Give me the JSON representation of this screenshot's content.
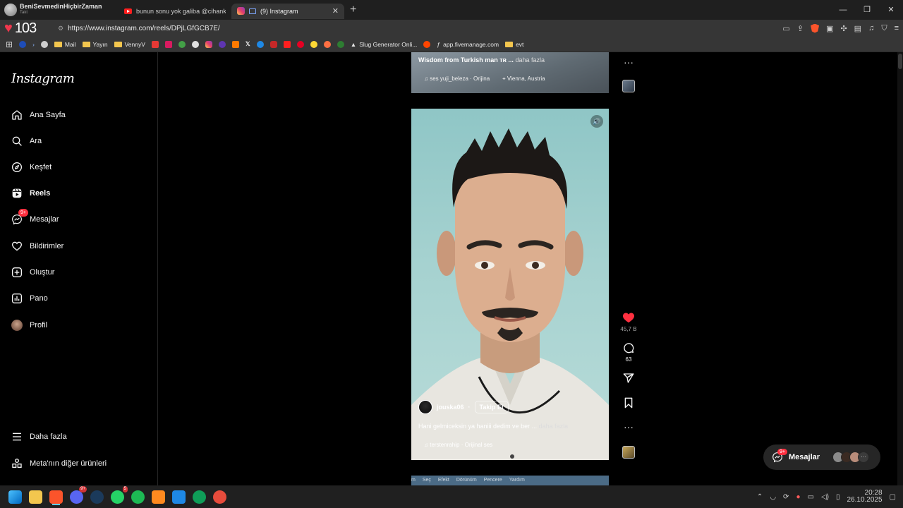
{
  "browser": {
    "profile": {
      "name": "BeniSevmedinHiçbirZaman",
      "sub": "Takt"
    },
    "tabs": [
      {
        "title": "bunun sonu yok galiba @cihankusku...",
        "type": "youtube"
      },
      {
        "title": "(9) Instagram",
        "type": "instagram",
        "active": true
      }
    ],
    "new_tab": "+",
    "window_controls": [
      "—",
      "❐",
      "✕"
    ],
    "heart_count": "103",
    "url": "https://www.instagram.com/reels/DPjLGfGCB7E/",
    "bookmarks": [
      {
        "label": "",
        "icon": "apps-icon"
      },
      {
        "label": "",
        "icon": "zte-icon"
      },
      {
        "label": "",
        "icon": "play-icon"
      },
      {
        "label": "",
        "icon": "chrome-icon"
      },
      {
        "label": "Mail",
        "icon": "folder-icon"
      },
      {
        "label": "Yayın",
        "icon": "folder-icon"
      },
      {
        "label": "VennyV",
        "icon": "folder-icon"
      },
      {
        "label": "Slug Generator Onli...",
        "icon": "slug-icon"
      },
      {
        "label": "app.fivemanage.com",
        "icon": "fivemanage-icon"
      },
      {
        "label": "evt",
        "icon": "folder-icon"
      }
    ]
  },
  "sidebar": {
    "logo": "Instagram",
    "items": [
      {
        "label": "Ana Sayfa",
        "icon": "home-icon"
      },
      {
        "label": "Ara",
        "icon": "search-icon"
      },
      {
        "label": "Keşfet",
        "icon": "compass-icon"
      },
      {
        "label": "Reels",
        "icon": "reels-icon",
        "active": true
      },
      {
        "label": "Mesajlar",
        "icon": "messenger-icon",
        "badge": "9+"
      },
      {
        "label": "Bildirimler",
        "icon": "heart-icon"
      },
      {
        "label": "Oluştur",
        "icon": "plus-square-icon"
      },
      {
        "label": "Pano",
        "icon": "chart-icon"
      },
      {
        "label": "Profil",
        "icon": "avatar"
      }
    ],
    "bottom": [
      {
        "label": "Daha fazla",
        "icon": "menu-icon"
      },
      {
        "label": "Meta'nın diğer ürünleri",
        "icon": "meta-apps-icon"
      }
    ]
  },
  "feed": {
    "prev_reel": {
      "caption": "Wisdom from Turkish man ᴛʀ ...",
      "more": "daha fazla",
      "audio": "ses  yuji_beleza · Orijina",
      "location": "Vienna, Austria"
    },
    "current_reel": {
      "author": "jouska06",
      "separator": "·",
      "follow_label": "Takip Et",
      "caption": "Hani gelmiceksin ya haniii dedim ve ber ...",
      "more": "daha fazla",
      "audio": "terstenrahip · Orijinal ses",
      "likes": "45,7 B",
      "comments": "63"
    },
    "next_reel_menu": [
      "m",
      "Seç",
      "Efekt",
      "Dörünüm",
      "Pencere",
      "Yardım"
    ]
  },
  "messages_pill": {
    "label": "Mesajlar",
    "badge": "9+"
  },
  "taskbar": {
    "apps": [
      {
        "name": "windows-start",
        "color": "#2b88d8"
      },
      {
        "name": "file-explorer",
        "color": "#f3c64e"
      },
      {
        "name": "brave",
        "color": "#fb542b",
        "active": true
      },
      {
        "name": "discord",
        "color": "#5865f2",
        "badge": "9+"
      },
      {
        "name": "steam",
        "color": "#1b3a5b"
      },
      {
        "name": "whatsapp",
        "color": "#25d366",
        "badge": "5"
      },
      {
        "name": "spotify",
        "color": "#1db954"
      },
      {
        "name": "app-orange",
        "color": "#ff8a1f"
      },
      {
        "name": "app-blue",
        "color": "#1e88e5"
      },
      {
        "name": "app-green",
        "color": "#0f9d58"
      },
      {
        "name": "app-chrome-like",
        "color": "#e74c3c"
      }
    ],
    "time": "20:28",
    "date": "26.10.2025"
  },
  "colors": {
    "accent_red": "#ff3040",
    "like_red": "#ff3040",
    "sidebar_border": "#262626"
  }
}
